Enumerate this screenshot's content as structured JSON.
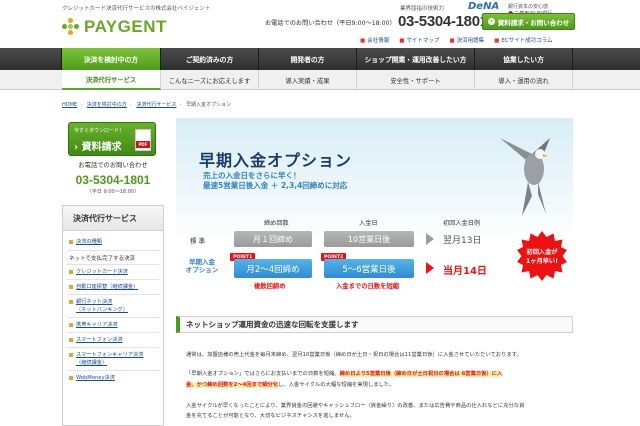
{
  "header": {
    "tagline": "クレジットカード決済代行サービスの株式会社ペイジェント",
    "logo_text": "PAYGENT",
    "group_text": "業界屈指の技術力",
    "dena_text": "DeNA",
    "ufj_caption": "銀行資本の安心感",
    "ufj_text": "三菱東京UFJ銀行",
    "tel_label": "お電話でのお問い合わせ（平日9:00〜18:00）",
    "tel_number": "03-5304-1801",
    "request_button": "資料請求・お問い合わせ",
    "sublinks": [
      "会社情報",
      "サイトマップ",
      "決済用語集",
      "ECサイト成功コラム"
    ]
  },
  "main_nav": [
    "決済を検討中の方",
    "ご契約済みの方",
    "開発者の方",
    "ショップ開業・運用改善したい方",
    "協業したい方"
  ],
  "sub_nav": [
    "決済代行サービス",
    "こんなニーズにお応えします",
    "導入実績・成果",
    "安全性・サポート",
    "導入・運用の流れ"
  ],
  "breadcrumb": [
    "HOME",
    "決済を検討中の方",
    "決済代行サービス",
    "早期入金オプション"
  ],
  "sidebar": {
    "download_small": "今すぐダウンロード！",
    "download_big": "資料請求",
    "pdf_label": "PDF",
    "contact_label": "お電話でのお問い合わせ",
    "tel": "03-5304-1801",
    "hours": "（平日 9:00〜18:00）",
    "menu_title": "決済代行サービス",
    "menu_items": [
      "決済の種類",
      "ネットで支払完了する決済",
      "クレジットカード決済",
      "自動口座振替（継続課金）",
      "銀行ネット決済",
      "（ネットバンキング）",
      "携帯キャリア決済",
      "スマートフォン決済",
      "スマートフォンキャリア決済",
      "（継続課金）",
      "WebMoney決済"
    ]
  },
  "banner": {
    "title": "早期入金オプション",
    "sub1": "売上の入金日をさらに早く！",
    "sub2": "最速5営業日後入金 ＋ 2,3,4回締めに対応",
    "col_headers": [
      "締め回数",
      "入金日",
      "初回入金日例"
    ],
    "row_standard": "標 準",
    "row_option": "早期入金\nオプション",
    "std_close": "月１回締め",
    "std_pay": "10営業日後",
    "std_result": "翌月13日",
    "opt_close": "月2〜4回締め",
    "opt_pay": "5〜6営業日後",
    "opt_result": "当月14日",
    "point1": "POINT1",
    "point2": "POINT2",
    "note1": "複数回締め",
    "note2": "入金までの日数を短縮",
    "burst_line1": "初回入金が",
    "burst_line2": "1ヶ月早い!"
  },
  "section": {
    "title": "ネットショップ運用資金の迅速な回転を支援します",
    "para1": "通常は、加盟店様の売上代金を毎月末締め、翌月10営業日後（締め日が土日・祝日の場合は11営業日後）に入金させていただいております。",
    "para2_a": "「早期入金オプション」ではさらにお支払いまでの日数を短縮。",
    "para2_hl1": "締め日より5営業日後（締め日が土日祝日の場合は 6営業日後）に入",
    "para2_hl2": "金、かつ締め回数を2〜4回まで細分化",
    "para2_b": "し、入金サイクルの大幅な短縮を実現しました。",
    "para3": "入金サイクルが早くなったことにより、業界資金の回避やキャッシュフロー（資金繰り）の改善、または広告費や商品の仕入れなどに充分な資",
    "para4": "金を充てることが可能となり、大切なビジネスチャンスを逃しません。"
  },
  "colors": {
    "accent_green": "#5aa91f",
    "accent_red": "#e11111",
    "accent_blue": "#2f83c6"
  }
}
